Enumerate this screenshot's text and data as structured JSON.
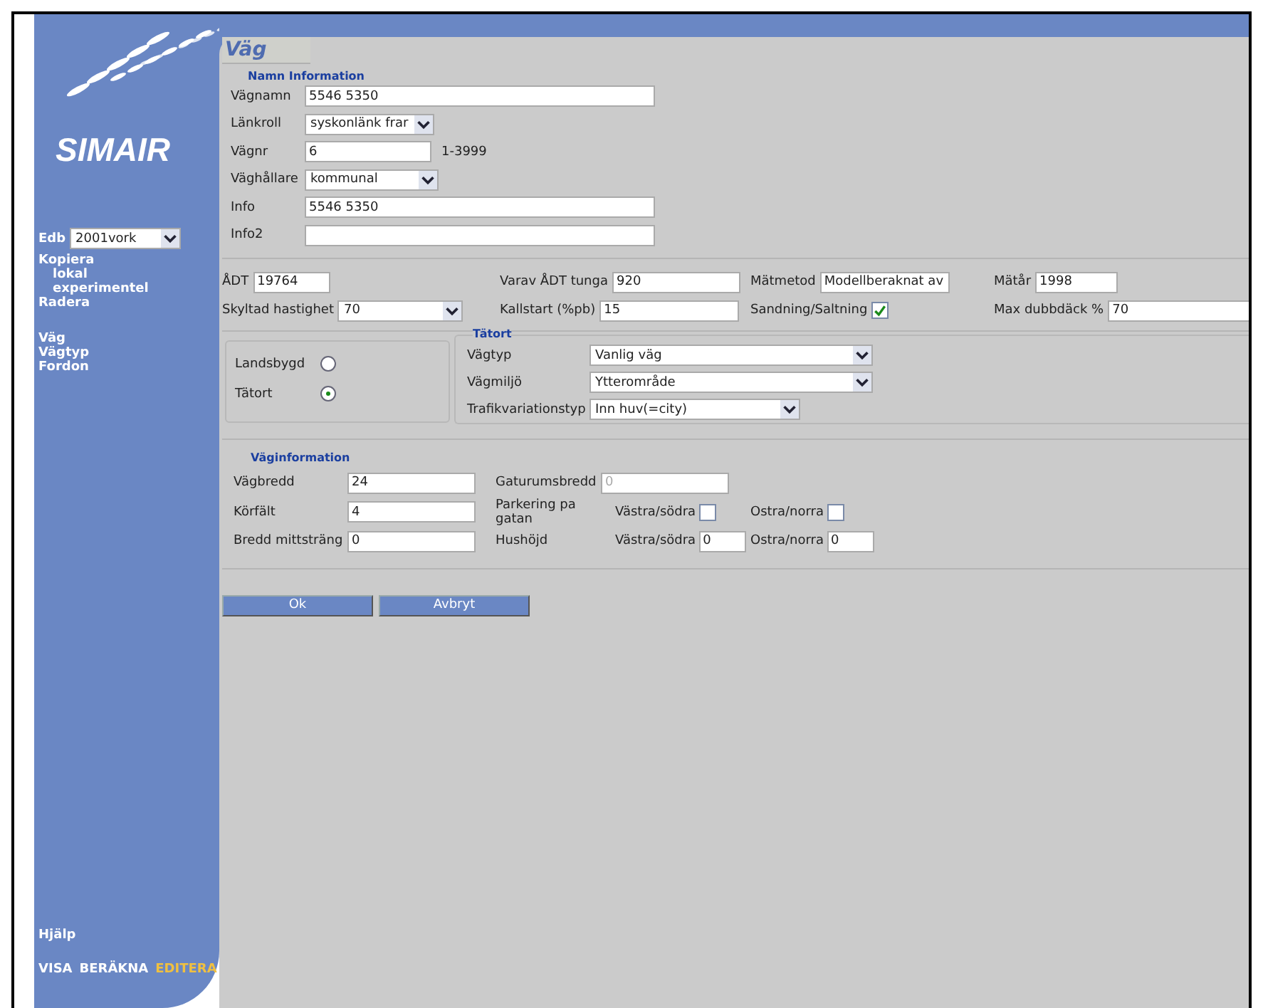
{
  "sidebar": {
    "logo": "SIMAIR",
    "edb": {
      "label": "Edb",
      "value": "2001vork"
    },
    "menu": [
      {
        "label": "Kopiera",
        "children": [
          {
            "label": "lokal"
          },
          {
            "label": "experimentel"
          }
        ]
      },
      {
        "label": "Radera"
      }
    ],
    "nav": [
      {
        "label": "Väg"
      },
      {
        "label": "Vägtyp"
      },
      {
        "label": "Fordon"
      }
    ],
    "help": "Hjälp",
    "modes": [
      {
        "label": "VISA",
        "selected": false
      },
      {
        "label": "BERÄKNA",
        "selected": false
      },
      {
        "label": "EDITERA",
        "selected": true
      }
    ]
  },
  "title": "Väg",
  "namn_information": {
    "legend": "Namn Information",
    "fields": [
      {
        "label": "Vägnamn",
        "kind": "text",
        "value": "5546 5350"
      },
      {
        "label": "Länkroll",
        "kind": "select",
        "value": "syskonlänk frar"
      },
      {
        "label": "Vägnr",
        "kind": "text",
        "value": "6",
        "note": "1-3999"
      },
      {
        "label": "Väghållare",
        "kind": "select",
        "value": "kommunal"
      },
      {
        "label": "Info",
        "kind": "text",
        "value": "5546 5350"
      },
      {
        "label": "Info2",
        "kind": "text"
      }
    ]
  },
  "traffic": [
    [
      {
        "label": "ÅDT",
        "kind": "text",
        "value": "19764"
      },
      {
        "label": "Varav ÅDT tunga",
        "kind": "text",
        "value": "920"
      },
      {
        "label": "Mätmetod",
        "kind": "text",
        "value": "Modellberaknat av"
      },
      {
        "label": "Mätår",
        "kind": "text",
        "value": "1998"
      }
    ],
    [
      {
        "label": "Skyltad hastighet",
        "kind": "select",
        "value": "70"
      },
      {
        "label": "Kallstart (%pb)",
        "kind": "text",
        "value": "15"
      },
      {
        "label": "Sandning/Saltning",
        "kind": "checkbox",
        "checked": true
      },
      {
        "label": "Max dubbdäck %",
        "kind": "text",
        "value": "70"
      }
    ]
  ],
  "area": [
    {
      "label": "Landsbygd",
      "selected": false
    },
    {
      "label": "Tätort",
      "selected": true
    }
  ],
  "tatort": {
    "legend": "Tätort",
    "fields": [
      {
        "label": "Vägtyp",
        "value": "Vanlig väg"
      },
      {
        "label": "Vägmiljö",
        "value": "Ytterområde"
      },
      {
        "label": "Trafikvariationstyp",
        "value": "Inn huv(=city)"
      }
    ]
  },
  "vaginformation": {
    "legend": "Väginformation",
    "left": [
      {
        "label": "Vägbredd",
        "value": "24"
      },
      {
        "label": "Körfält",
        "value": "4"
      },
      {
        "label": "Bredd mittsträng",
        "value": "0"
      }
    ],
    "gaturumsbredd": {
      "label": "Gaturumsbredd",
      "value": "0",
      "disabled": true
    },
    "parkering": {
      "label": "Parkering pa gatan",
      "sides": [
        {
          "label": "Västra/södra",
          "checked": false
        },
        {
          "label": "Ostra/norra",
          "checked": false
        }
      ]
    },
    "hushojd": {
      "label": "Hushöjd",
      "sides": [
        {
          "label": "Västra/södra",
          "value": "0"
        },
        {
          "label": "Ostra/norra",
          "value": "0"
        }
      ]
    }
  },
  "buttons": [
    "Ok",
    "Avbryt"
  ]
}
